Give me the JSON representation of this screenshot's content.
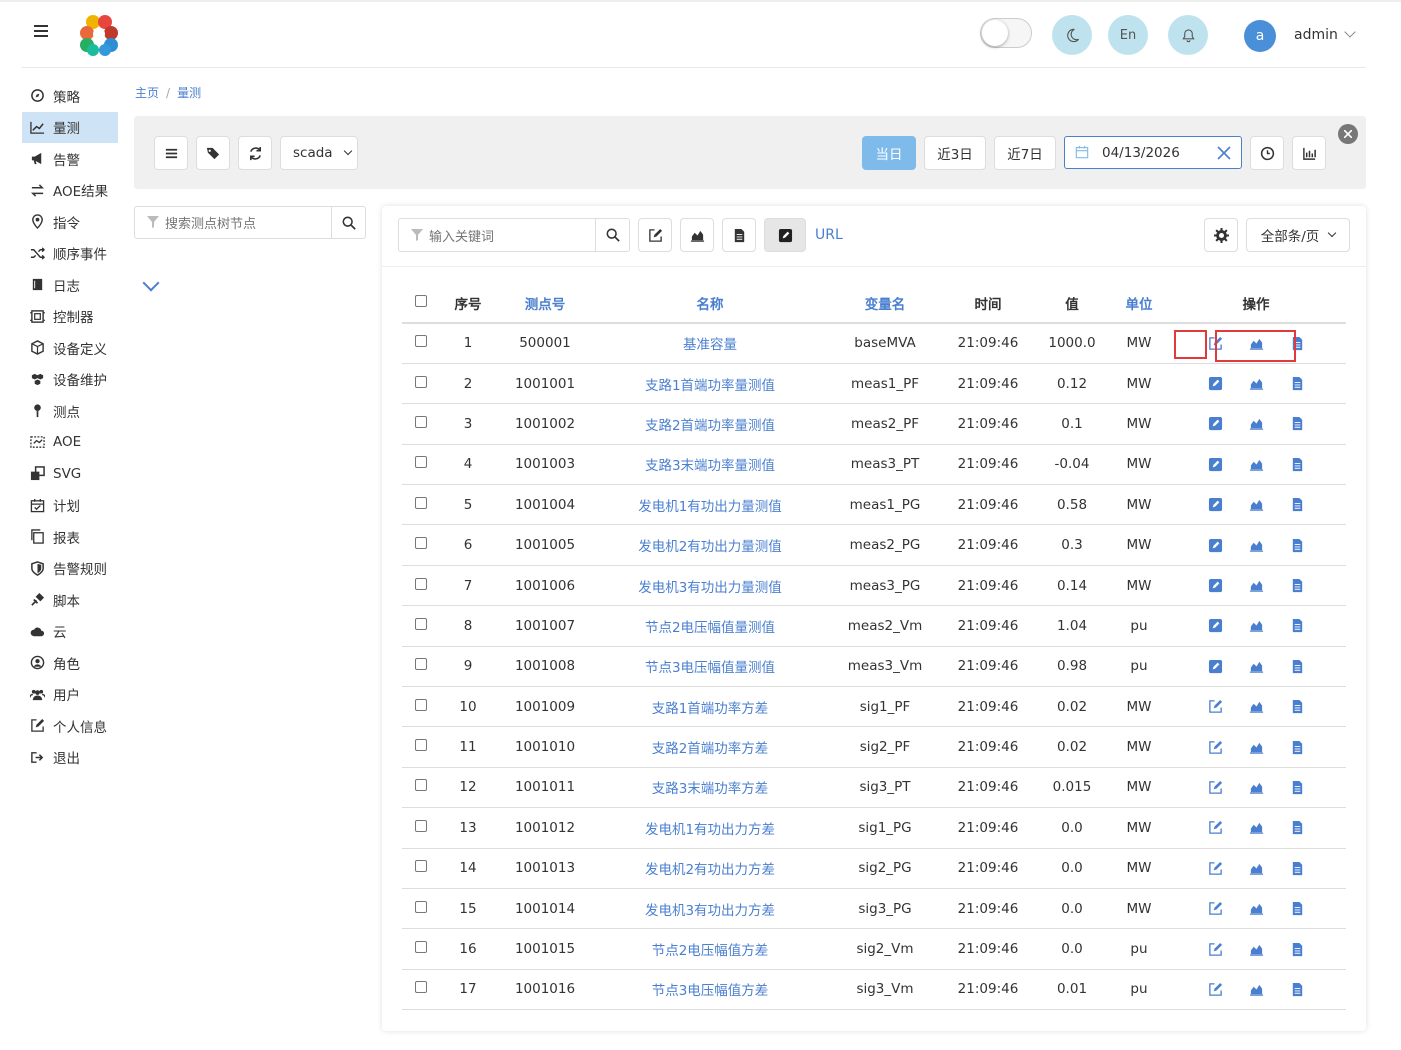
{
  "header": {
    "theme_toggle": "off",
    "night_icon": "moon-icon",
    "lang_label": "En",
    "bell_icon": "bell-icon",
    "avatar_letter": "a",
    "username": "admin"
  },
  "sidebar": {
    "active_index": 1,
    "items": [
      {
        "label": "策略",
        "icon": "strategy-icon"
      },
      {
        "label": "量测",
        "icon": "chart-line-icon"
      },
      {
        "label": "告警",
        "icon": "bullhorn-icon"
      },
      {
        "label": "AOE结果",
        "icon": "exchange-icon"
      },
      {
        "label": "指令",
        "icon": "pin-icon"
      },
      {
        "label": "顺序事件",
        "icon": "shuffle-icon"
      },
      {
        "label": "日志",
        "icon": "book-icon"
      },
      {
        "label": "控制器",
        "icon": "controller-icon"
      },
      {
        "label": "设备定义",
        "icon": "cube-icon"
      },
      {
        "label": "设备维护",
        "icon": "cubes-icon"
      },
      {
        "label": "测点",
        "icon": "marker-icon"
      },
      {
        "label": "AOE",
        "icon": "diagram-icon"
      },
      {
        "label": "SVG",
        "icon": "clone-icon"
      },
      {
        "label": "计划",
        "icon": "calendar-check-icon"
      },
      {
        "label": "报表",
        "icon": "copy-icon"
      },
      {
        "label": "告警规则",
        "icon": "shield-icon"
      },
      {
        "label": "脚本",
        "icon": "plug-icon"
      },
      {
        "label": "云",
        "icon": "cloud-icon"
      },
      {
        "label": "角色",
        "icon": "user-circle-icon"
      },
      {
        "label": "用户",
        "icon": "users-icon"
      },
      {
        "label": "个人信息",
        "icon": "edit-icon"
      },
      {
        "label": "退出",
        "icon": "sign-out-icon"
      }
    ]
  },
  "breadcrumb": {
    "home": "主页",
    "current": "量测"
  },
  "toolbar": {
    "source": "scada",
    "today": "当日",
    "last3": "近3日",
    "last7": "近7日",
    "date": "04/13/2026"
  },
  "tree": {
    "placeholder": "搜索测点树节点"
  },
  "table_tools": {
    "placeholder": "输入关键词",
    "url_label": "URL",
    "page_size": "全部条/页"
  },
  "table": {
    "headers": [
      "序号",
      "测点号",
      "名称",
      "变量名",
      "时间",
      "值",
      "单位",
      "操作"
    ],
    "rows": [
      {
        "seq": "1",
        "id": "500001",
        "name": "基准容量",
        "var": "baseMVA",
        "time": "21:09:46",
        "value": "1000.0",
        "unit": "MW",
        "edit_style": "outline"
      },
      {
        "seq": "2",
        "id": "1001001",
        "name": "支路1首端功率量测值",
        "var": "meas1_PF",
        "time": "21:09:46",
        "value": "0.12",
        "unit": "MW",
        "edit_style": "solid"
      },
      {
        "seq": "3",
        "id": "1001002",
        "name": "支路2首端功率量测值",
        "var": "meas2_PF",
        "time": "21:09:46",
        "value": "0.1",
        "unit": "MW",
        "edit_style": "solid"
      },
      {
        "seq": "4",
        "id": "1001003",
        "name": "支路3末端功率量测值",
        "var": "meas3_PT",
        "time": "21:09:46",
        "value": "-0.04",
        "unit": "MW",
        "edit_style": "solid"
      },
      {
        "seq": "5",
        "id": "1001004",
        "name": "发电机1有功出力量测值",
        "var": "meas1_PG",
        "time": "21:09:46",
        "value": "0.58",
        "unit": "MW",
        "edit_style": "solid"
      },
      {
        "seq": "6",
        "id": "1001005",
        "name": "发电机2有功出力量测值",
        "var": "meas2_PG",
        "time": "21:09:46",
        "value": "0.3",
        "unit": "MW",
        "edit_style": "solid"
      },
      {
        "seq": "7",
        "id": "1001006",
        "name": "发电机3有功出力量测值",
        "var": "meas3_PG",
        "time": "21:09:46",
        "value": "0.14",
        "unit": "MW",
        "edit_style": "solid"
      },
      {
        "seq": "8",
        "id": "1001007",
        "name": "节点2电压幅值量测值",
        "var": "meas2_Vm",
        "time": "21:09:46",
        "value": "1.04",
        "unit": "pu",
        "edit_style": "solid"
      },
      {
        "seq": "9",
        "id": "1001008",
        "name": "节点3电压幅值量测值",
        "var": "meas3_Vm",
        "time": "21:09:46",
        "value": "0.98",
        "unit": "pu",
        "edit_style": "solid"
      },
      {
        "seq": "10",
        "id": "1001009",
        "name": "支路1首端功率方差",
        "var": "sig1_PF",
        "time": "21:09:46",
        "value": "0.02",
        "unit": "MW",
        "edit_style": "outline"
      },
      {
        "seq": "11",
        "id": "1001010",
        "name": "支路2首端功率方差",
        "var": "sig2_PF",
        "time": "21:09:46",
        "value": "0.02",
        "unit": "MW",
        "edit_style": "outline"
      },
      {
        "seq": "12",
        "id": "1001011",
        "name": "支路3末端功率方差",
        "var": "sig3_PT",
        "time": "21:09:46",
        "value": "0.015",
        "unit": "MW",
        "edit_style": "outline"
      },
      {
        "seq": "13",
        "id": "1001012",
        "name": "发电机1有功出力方差",
        "var": "sig1_PG",
        "time": "21:09:46",
        "value": "0.0",
        "unit": "MW",
        "edit_style": "outline"
      },
      {
        "seq": "14",
        "id": "1001013",
        "name": "发电机2有功出力方差",
        "var": "sig2_PG",
        "time": "21:09:46",
        "value": "0.0",
        "unit": "MW",
        "edit_style": "outline"
      },
      {
        "seq": "15",
        "id": "1001014",
        "name": "发电机3有功出力方差",
        "var": "sig3_PG",
        "time": "21:09:46",
        "value": "0.0",
        "unit": "MW",
        "edit_style": "outline"
      },
      {
        "seq": "16",
        "id": "1001015",
        "name": "节点2电压幅值方差",
        "var": "sig2_Vm",
        "time": "21:09:46",
        "value": "0.0",
        "unit": "pu",
        "edit_style": "outline"
      },
      {
        "seq": "17",
        "id": "1001016",
        "name": "节点3电压幅值方差",
        "var": "sig3_Vm",
        "time": "21:09:46",
        "value": "0.01",
        "unit": "pu",
        "edit_style": "outline"
      }
    ]
  },
  "colors": {
    "accent": "#4a7fd0",
    "primary_button": "#7fbbea",
    "active_nav": "#cfe3f7",
    "highlight": "#e03a3a"
  }
}
